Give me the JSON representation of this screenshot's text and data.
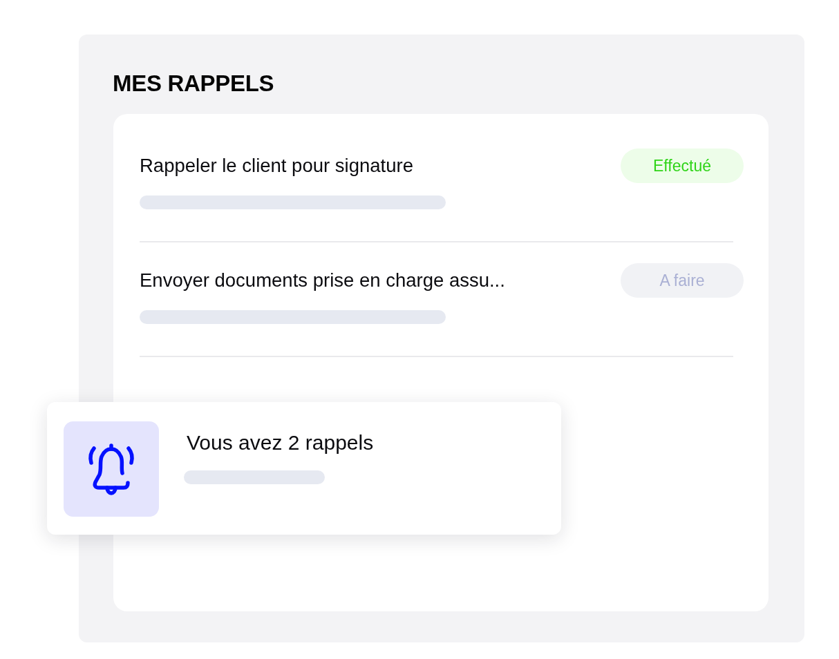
{
  "section": {
    "title": "MES RAPPELS"
  },
  "reminders": [
    {
      "title": "Rappeler le client pour signature",
      "status": {
        "label": "Effectué",
        "kind": "done"
      }
    },
    {
      "title": "Envoyer documents prise en charge assu...",
      "status": {
        "label": "A faire",
        "kind": "todo"
      }
    }
  ],
  "notification": {
    "message": "Vous avez 2 rappels"
  }
}
